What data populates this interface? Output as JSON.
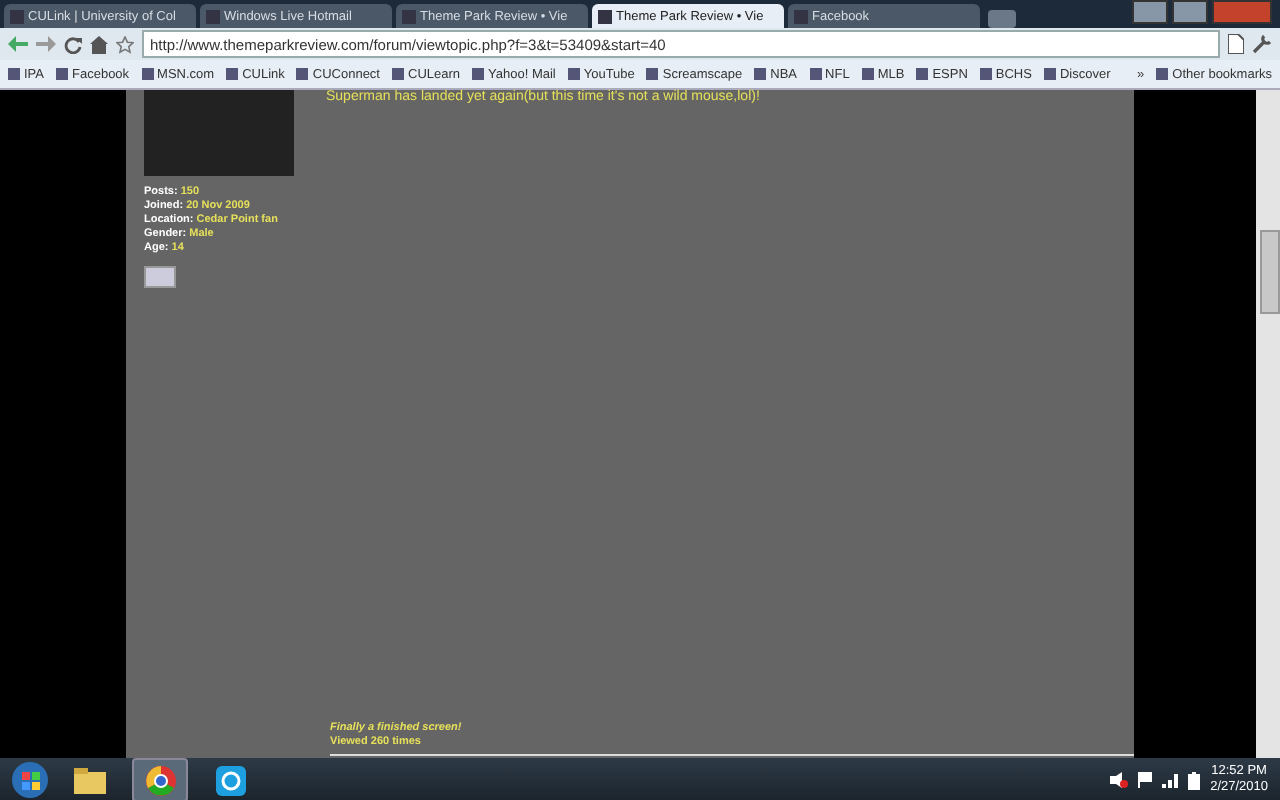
{
  "browser": {
    "tabs": [
      {
        "title": "CULink | University of Col",
        "selected": false
      },
      {
        "title": "Windows Live Hotmail",
        "selected": false
      },
      {
        "title": "Theme Park Review • Vie",
        "selected": false
      },
      {
        "title": "Theme Park Review • Vie",
        "selected": true
      },
      {
        "title": "Facebook",
        "selected": false
      }
    ],
    "url": "http://www.themeparkreview.com/forum/viewtopic.php?f=3&t=53409&start=40",
    "bookmarks": [
      "IPA",
      "Facebook",
      "MSN.com",
      "CULink",
      "CUConnect",
      "CULearn",
      "Yahoo! Mail",
      "YouTube",
      "Screamscape",
      "NBA",
      "NFL",
      "MLB",
      "ESPN",
      "BCHS",
      "Discover"
    ],
    "overflow": "»",
    "other_bookmarks": "Other bookmarks"
  },
  "post": {
    "profile": [
      {
        "label": "Posts:",
        "value": "150"
      },
      {
        "label": "Joined:",
        "value": "20 Nov 2009"
      },
      {
        "label": "Location:",
        "value": "Cedar Point fan"
      },
      {
        "label": "Gender:",
        "value": "Male"
      },
      {
        "label": "Age:",
        "value": "14"
      }
    ],
    "message": "Superman has landed yet again(but this time it's not a wild mouse,lol)!",
    "signature": "Finally a finished screen!",
    "views": "Viewed 260 times"
  },
  "taskbar": {
    "apps": [
      {
        "kind": "explorer",
        "selected": false
      },
      {
        "kind": "chrome",
        "selected": true
      },
      {
        "kind": "skype",
        "selected": false
      }
    ],
    "time": "12:52 PM",
    "date": "2/27/2010"
  }
}
